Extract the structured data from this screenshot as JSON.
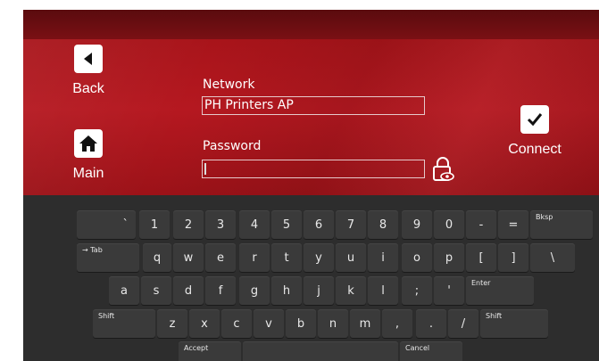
{
  "nav": {
    "back_label": "Back",
    "main_label": "Main",
    "connect_label": "Connect"
  },
  "form": {
    "network_label": "Network",
    "network_value": "PH Printers AP",
    "password_label": "Password",
    "password_value": ""
  },
  "icons": {
    "back": "back-arrow-icon",
    "main": "home-icon",
    "connect": "checkmark-icon",
    "password_toggle": "lock-eye-icon"
  },
  "colors": {
    "accent_red": "#b51820",
    "keyboard_bg": "#2d2d2d",
    "key_bg": "#3a3a3a"
  },
  "keyboard": {
    "row1": [
      "`",
      "1",
      "2",
      "3",
      "4",
      "5",
      "6",
      "7",
      "8",
      "9",
      "0",
      "-",
      "=",
      "Bksp"
    ],
    "row2": [
      "→ Tab",
      "q",
      "w",
      "e",
      "r",
      "t",
      "y",
      "u",
      "i",
      "o",
      "p",
      "[",
      "]",
      "\\"
    ],
    "row3": [
      "a",
      "s",
      "d",
      "f",
      "g",
      "h",
      "j",
      "k",
      "l",
      ";",
      "'",
      "Enter"
    ],
    "row4": [
      "Shift",
      "z",
      "x",
      "c",
      "v",
      "b",
      "n",
      "m",
      ",",
      ".",
      "/",
      "Shift"
    ],
    "row5": [
      "Accept",
      "",
      "Cancel"
    ]
  }
}
